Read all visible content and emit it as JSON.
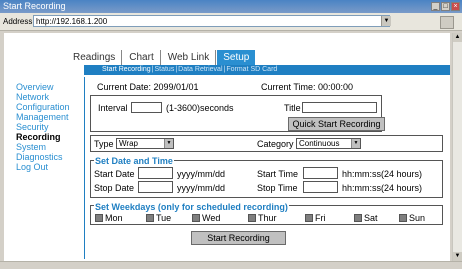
{
  "window": {
    "title": "Start Recording"
  },
  "addressbar": {
    "label": "Address",
    "url": "http://192.168.1.200"
  },
  "tabs": [
    {
      "label": "Readings"
    },
    {
      "label": "Chart"
    },
    {
      "label": "Web Link"
    },
    {
      "label": "Setup"
    }
  ],
  "subnav": [
    {
      "label": "Start Recording"
    },
    {
      "label": "Status"
    },
    {
      "label": "Data Retrieval"
    },
    {
      "label": "Format SD Card"
    }
  ],
  "sidebar": {
    "items": [
      {
        "label": "Overview"
      },
      {
        "label": "Network"
      },
      {
        "label": "Configuration"
      },
      {
        "label": "Management"
      },
      {
        "label": "Security"
      },
      {
        "label": "Recording"
      },
      {
        "label": "System"
      },
      {
        "label": "Diagnostics"
      },
      {
        "label": "Log Out"
      }
    ]
  },
  "status": {
    "current_date": "Current Date: 2099/01/01",
    "current_time": "Current Time: 00:00:00"
  },
  "recording": {
    "interval_label": "Interval",
    "interval_value": "",
    "interval_hint": "(1-3600)seconds",
    "title_label": "Title",
    "title_value": "",
    "quick_start_label": "Quick Start Recording",
    "type_label": "Type",
    "type_value": "Wrap",
    "category_label": "Category",
    "category_value": "Continuous"
  },
  "set_date_time": {
    "legend": "Set Date and Time",
    "start_date_label": "Start Date",
    "start_date_format": "yyyy/mm/dd",
    "stop_date_label": "Stop Date",
    "stop_date_format": "yyyy/mm/dd",
    "start_time_label": "Start Time",
    "start_time_format": "hh:mm:ss(24 hours)",
    "stop_time_label": "Stop Time",
    "stop_time_format": "hh:mm:ss(24 hours)"
  },
  "weekdays": {
    "legend": "Set Weekdays (only for scheduled recording)",
    "days": [
      "Mon",
      "Tue",
      "Wed",
      "Thur",
      "Fri",
      "Sat",
      "Sun"
    ]
  },
  "start_button_label": "Start Recording",
  "colors": {
    "accent": "#2a8fd1",
    "navbar": "#1f7fc2"
  }
}
